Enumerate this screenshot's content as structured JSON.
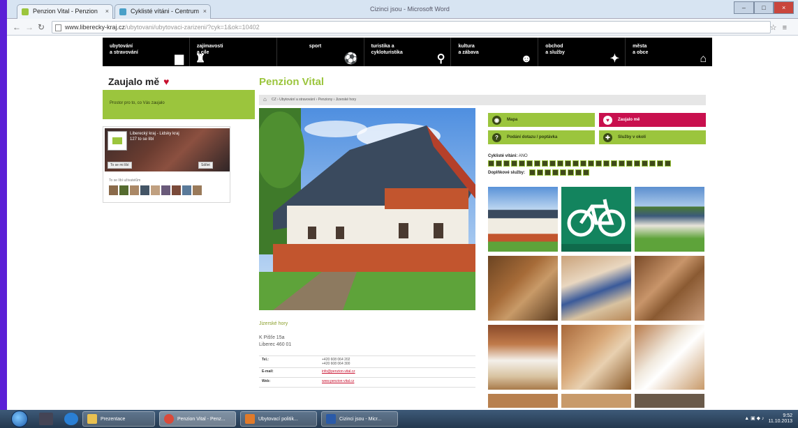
{
  "browser": {
    "tabs": [
      {
        "label": "Penzion Vital - Penzion"
      },
      {
        "label": "Cyklisté vítáni - Centrum"
      }
    ],
    "window_title": "Cizinci jsou - Microsoft Word",
    "url_host": "www.liberecky-kraj.cz",
    "url_path": "/ubytovani/ubytovaci-zarizeni/?cyk=1&ok=10402"
  },
  "topnav": [
    {
      "label": "ubytování\na stravování",
      "icon": "bed-icon"
    },
    {
      "label": "zajímavosti\na cíle",
      "icon": "castle-icon"
    },
    {
      "label": "sport",
      "icon": "ball-icon"
    },
    {
      "label": "turistika a\ncykloturistika",
      "icon": "bike-icon"
    },
    {
      "label": "kultura\na zábava",
      "icon": "masks-icon"
    },
    {
      "label": "obchod\na služby",
      "icon": "shopping-icon"
    },
    {
      "label": "města\na obce",
      "icon": "home-icon"
    }
  ],
  "sidebar": {
    "zaujalo_title": "Zaujalo mě",
    "zaujalo_text": "Prostor pro to, co Vás zaujalo",
    "fb_page_name": "Liberecký kraj - Lidsky kraj",
    "fb_likes": "127 to se líbí",
    "fb_like_button": "To se mi líbí",
    "fb_share_button": "Sdílet",
    "fb_friends_label": "To se líbí uživatelům"
  },
  "main": {
    "title": "Penzion Vital",
    "breadcrumb": "CZ › Ubytování a stravování › Penziony › Jizerské hory",
    "region": "Jizerské hory",
    "address_line1": "K Pišťe 15a",
    "address_line2": "Liberec 460 01",
    "contacts": [
      {
        "key": "Tel.:",
        "value": "+420 608 064 202\n+420 608 064 300",
        "link": false
      },
      {
        "key": "E-mail:",
        "value": "info@penzion-vital.cz",
        "link": true
      },
      {
        "key": "Web:",
        "value": "www.penzion-vital.cz",
        "link": true
      }
    ],
    "actions": [
      {
        "label": "Mapa",
        "icon": "map-icon",
        "style": "green"
      },
      {
        "label": "Zaujalo mě",
        "icon": "heart-icon",
        "style": "red"
      },
      {
        "label": "Podání dotazu / poptávka",
        "icon": "question-icon",
        "style": "green"
      },
      {
        "label": "Služby v okolí",
        "icon": "services-icon",
        "style": "green"
      }
    ],
    "facility_label1": "Cyklisté vítáni:",
    "facility_value1": "ANO",
    "facility_label2": "Doplňkové služby:"
  },
  "taskbar": {
    "tasks": [
      "Prezentace",
      "Penzion Vital - Penz...",
      "Ubytovací politik...",
      "Cizinci jsou - Micr..."
    ],
    "time": "9:52",
    "date": "11.10.2013"
  },
  "colors": {
    "accent_green": "#9bc53d",
    "accent_red": "#c8104e",
    "nav_black": "#000000"
  }
}
